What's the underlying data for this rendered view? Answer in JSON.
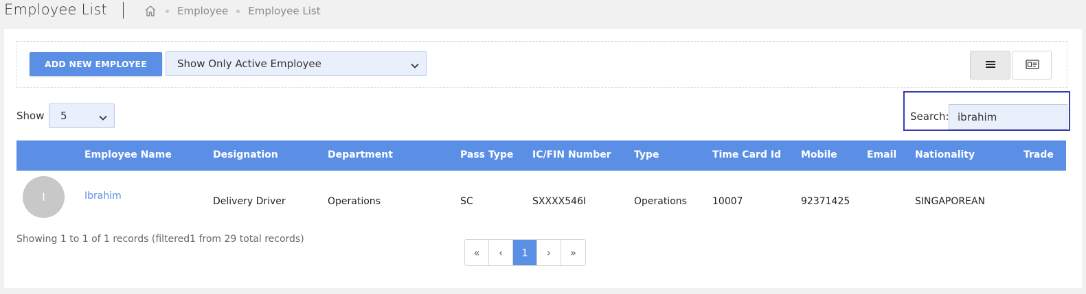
{
  "header": {
    "title": "Employee List",
    "breadcrumb": [
      "Employee",
      "Employee List"
    ]
  },
  "toolbar": {
    "add_label": "ADD NEW EMPLOYEE",
    "filter_value": "Show Only Active Employee"
  },
  "length": {
    "label": "Show",
    "value": "5"
  },
  "search": {
    "label": "Search:",
    "value": "ibrahim"
  },
  "table": {
    "columns": [
      "Employee Name",
      "Designation",
      "Department",
      "Pass Type",
      "IC/FIN Number",
      "Type",
      "Time Card Id",
      "Mobile",
      "Email",
      "Nationality",
      "Trade"
    ],
    "rows": [
      {
        "avatar_initial": "I",
        "name": "Ibrahim",
        "designation": "Delivery Driver",
        "department": "Operations",
        "pass_type": "SC",
        "ic_fin": "SXXXX546I",
        "type": "Operations",
        "time_card_id": "10007",
        "mobile": "92371425",
        "email": "",
        "nationality": "SINGAPOREAN",
        "trade": ""
      }
    ]
  },
  "footer": {
    "info": "Showing 1 to 1 of 1 records (filtered1 from 29 total records)"
  },
  "pagination": {
    "first": "«",
    "prev": "‹",
    "current": "1",
    "next": "›",
    "last": "»"
  },
  "colors": {
    "accent": "#5b8fe6",
    "highlight_border": "#3a3aa8"
  }
}
